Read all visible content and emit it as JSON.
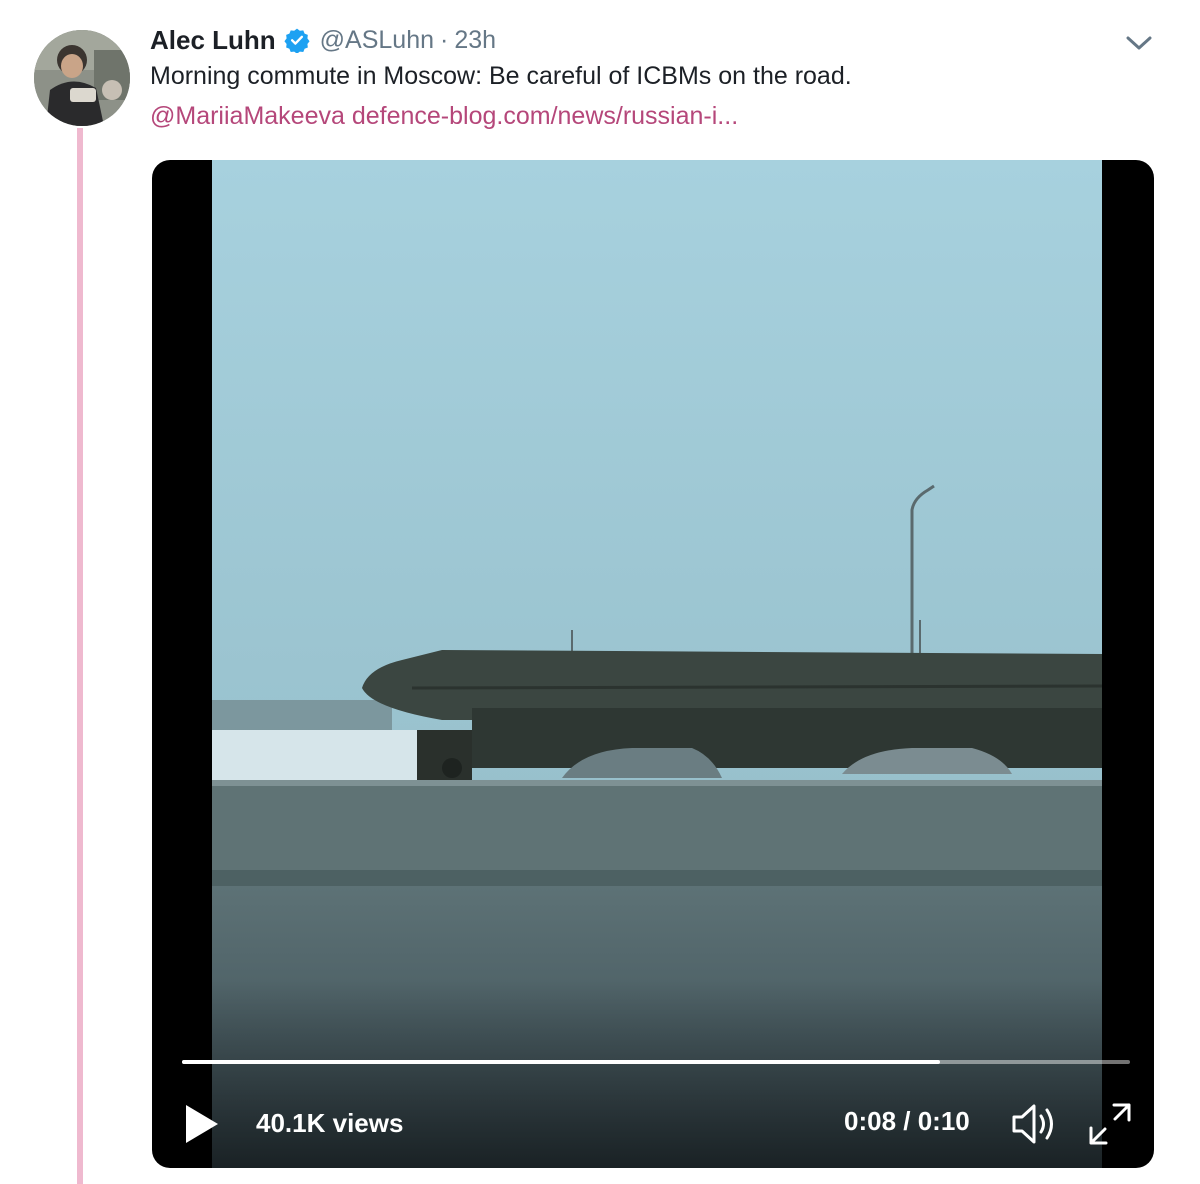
{
  "tweet": {
    "author_name": "Alec Luhn",
    "handle": "@ASLuhn",
    "separator": "·",
    "time": "23h",
    "text": "Morning commute in Moscow: Be careful of ICBMs on the road.",
    "mention": "@MariiaMakeeva",
    "link": "defence-blog.com/news/russian-i..."
  },
  "video": {
    "views": "40.1K views",
    "time_display": "0:08 / 0:10",
    "progress": 0.8
  },
  "icons": {
    "verified": "verified-badge-icon",
    "menu": "chevron-down-icon",
    "play": "play-icon",
    "volume": "volume-icon",
    "fullscreen": "fullscreen-icon"
  },
  "colors": {
    "thread_line": "#efb9cf",
    "link": "#b5477a",
    "verified": "#1da1f2",
    "secondary_text": "#657786"
  }
}
